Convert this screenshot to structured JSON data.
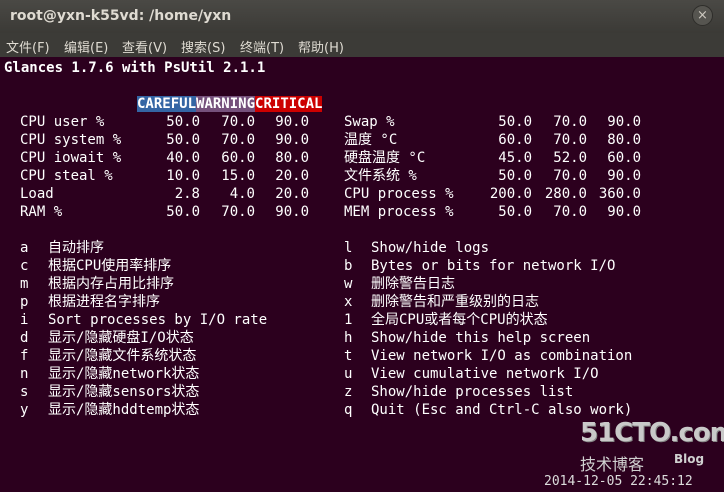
{
  "window": {
    "title": "root@yxn-k55vd: /home/yxn",
    "close_glyph": "×"
  },
  "menu": [
    "文件(F)",
    "编辑(E)",
    "查看(V)",
    "搜索(S)",
    "终端(T)",
    "帮助(H)"
  ],
  "header": "Glances 1.7.6 with PsUtil 2.1.1",
  "legend": {
    "careful": "CAREFUL",
    "warning": "WARNING",
    "critical": "CRITICAL"
  },
  "thresholds_left": [
    {
      "label": "CPU user %",
      "careful": "50.0",
      "warning": "70.0",
      "critical": "90.0"
    },
    {
      "label": "CPU system %",
      "careful": "50.0",
      "warning": "70.0",
      "critical": "90.0"
    },
    {
      "label": "CPU iowait %",
      "careful": "40.0",
      "warning": "60.0",
      "critical": "80.0"
    },
    {
      "label": "CPU steal %",
      "careful": "10.0",
      "warning": "15.0",
      "critical": "20.0"
    },
    {
      "label": "Load",
      "careful": "2.8",
      "warning": "4.0",
      "critical": "20.0"
    },
    {
      "label": "RAM %",
      "careful": "50.0",
      "warning": "70.0",
      "critical": "90.0"
    }
  ],
  "thresholds_right": [
    {
      "label": "Swap %",
      "careful": "50.0",
      "warning": "70.0",
      "critical": "90.0"
    },
    {
      "label": "温度 °C",
      "careful": "60.0",
      "warning": "70.0",
      "critical": "80.0"
    },
    {
      "label": "硬盘温度 °C",
      "careful": "45.0",
      "warning": "52.0",
      "critical": "60.0"
    },
    {
      "label": "文件系统 %",
      "careful": "50.0",
      "warning": "70.0",
      "critical": "90.0"
    },
    {
      "label": "CPU process %",
      "careful": "200.0",
      "warning": "280.0",
      "critical": "360.0"
    },
    {
      "label": "MEM process %",
      "careful": "50.0",
      "warning": "70.0",
      "critical": "90.0"
    }
  ],
  "keys_left": [
    {
      "key": "a",
      "desc": "自动排序"
    },
    {
      "key": "c",
      "desc": "根据CPU使用率排序"
    },
    {
      "key": "m",
      "desc": "根据内存占用比排序"
    },
    {
      "key": "p",
      "desc": "根据进程名字排序"
    },
    {
      "key": "i",
      "desc": "Sort processes by I/O rate"
    },
    {
      "key": "d",
      "desc": "显示/隐藏硬盘I/O状态"
    },
    {
      "key": "f",
      "desc": "显示/隐藏文件系统状态"
    },
    {
      "key": "n",
      "desc": "显示/隐藏network状态"
    },
    {
      "key": "s",
      "desc": "显示/隐藏sensors状态"
    },
    {
      "key": "y",
      "desc": "显示/隐藏hddtemp状态"
    }
  ],
  "keys_right": [
    {
      "key": "l",
      "desc": "Show/hide logs"
    },
    {
      "key": "b",
      "desc": "Bytes or bits for network I/O"
    },
    {
      "key": "w",
      "desc": "删除警告日志"
    },
    {
      "key": "x",
      "desc": "删除警告和严重级别的日志"
    },
    {
      "key": "1",
      "desc": "全局CPU或者每个CPU的状态"
    },
    {
      "key": "h",
      "desc": "Show/hide this help screen"
    },
    {
      "key": "t",
      "desc": "View network I/O as combination"
    },
    {
      "key": "u",
      "desc": "View cumulative network I/O"
    },
    {
      "key": "z",
      "desc": "Show/hide processes list"
    },
    {
      "key": "q",
      "desc": "Quit (Esc and Ctrl-C also work)"
    }
  ],
  "watermark": {
    "site": "51CTO.com",
    "sub": "技术博客",
    "blog": "Blog"
  },
  "timestamp": "2014-12-05 22:45:12",
  "colors": {
    "background": "#2c001e",
    "careful": "#3465a4",
    "warning": "#75507b",
    "critical": "#cc0000"
  }
}
